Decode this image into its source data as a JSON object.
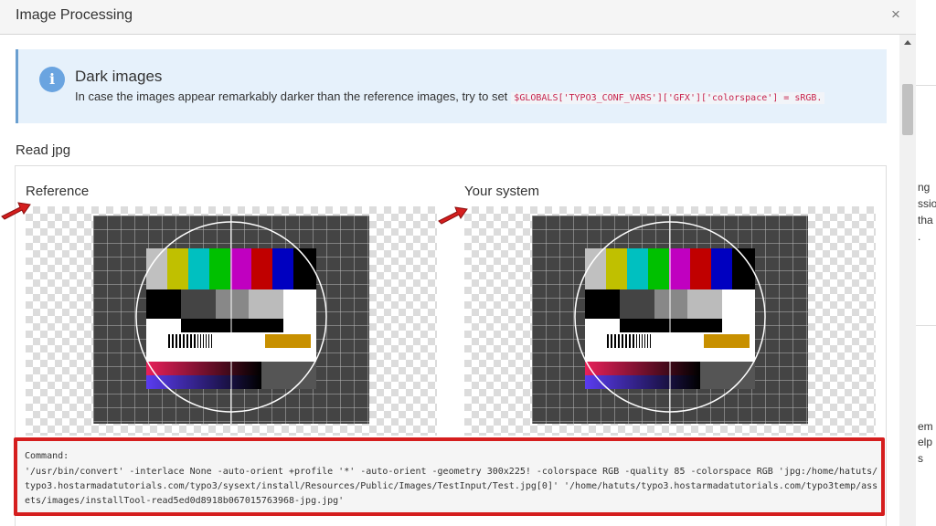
{
  "modal": {
    "title": "Image Processing",
    "close_glyph": "×"
  },
  "callout": {
    "icon": "info-icon",
    "icon_glyph": "i",
    "title": "Dark images",
    "text": "In case the images appear remarkably darker than the reference images, try to set",
    "code": "$GLOBALS['TYPO3_CONF_VARS']['GFX']['colorspace'] = sRGB."
  },
  "section": {
    "title": "Read jpg"
  },
  "reference": {
    "label": "Reference"
  },
  "system": {
    "label": "Your system"
  },
  "command": {
    "label": "Command:",
    "text": "'/usr/bin/convert' -interlace None -auto-orient +profile '*' -auto-orient -geometry 300x225! -colorspace RGB -quality 85  -colorspace RGB 'jpg:/home/hatuts/typo3.hostarmadatutorials.com/typo3/sysext/install/Resources/Public/Images/TestInput/Test.jpg[0]' '/home/hatuts/typo3.hostarmadatutorials.com/typo3temp/assets/images/installTool-read5ed0d8918b067015763968-jpg.jpg'"
  },
  "background_page": {
    "fragments": [
      "ng",
      "ssio",
      "tha",
      ".",
      "em",
      "elp",
      "s"
    ]
  },
  "colors": {
    "accent_red": "#d51e1e",
    "info_blue": "#6aa4e0",
    "callout_bg": "#e6f1fb"
  }
}
